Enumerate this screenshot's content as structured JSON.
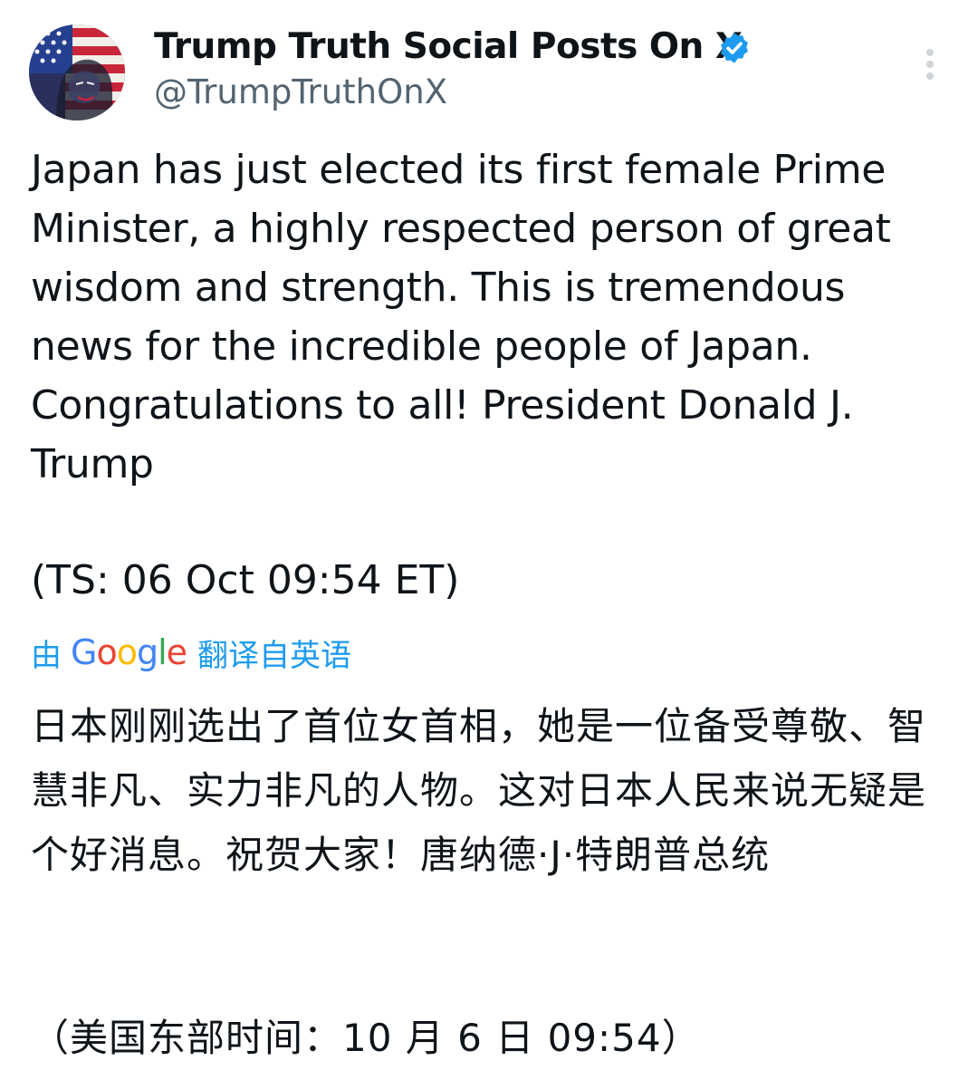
{
  "post": {
    "author": {
      "display_name": "Trump Truth Social Posts On X",
      "handle": "@TrumpTruthOnX",
      "verified": true,
      "verified_color": "#1d9bf0",
      "avatar_icon": "stars-and-stripes-portrait-avatar"
    },
    "menu_icon": "vertical-ellipsis-icon",
    "text": "Japan has just elected its first female Prime Minister, a highly respected person of great wisdom and strength. This is tremendous news for the incredible people of Japan. Congratulations to all! President Donald J. Trump",
    "timestamp_note": "(TS: 06 Oct 09:54 ET)",
    "translation": {
      "prefix": "由",
      "provider_logo_text": "Google",
      "suffix": "翻译自英语",
      "link_color": "#1d9bf0",
      "text": "日本刚刚选出了首位女首相，她是一位备受尊敬、智慧非凡、实力非凡的人物。这对日本人民来说无疑是个好消息。祝贺大家！唐纳德·J·特朗普总统",
      "timestamp_note": "（美国东部时间：10 月 6 日 09:54）"
    }
  }
}
